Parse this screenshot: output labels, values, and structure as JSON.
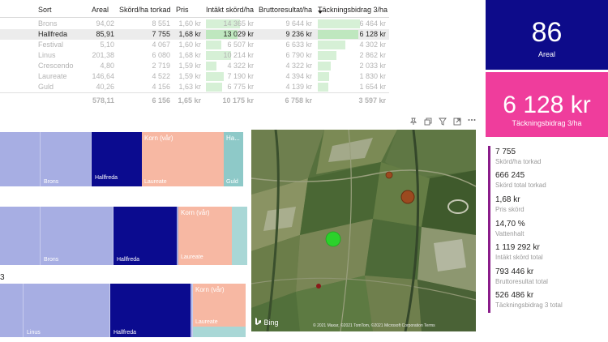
{
  "table": {
    "headers": [
      "Sort",
      "Areal",
      "Skörd/ha torkad",
      "Pris",
      "Intäkt skörd/ha",
      "Bruttoresultat/ha",
      "Täckningsbidrag 3/ha"
    ],
    "rows": [
      {
        "sort": "Brons",
        "areal": "94,02",
        "skord": "8 551",
        "pris": "1,60 kr",
        "intakt": "14 365 kr",
        "brutto": "9 644 kr",
        "tb": "6 464 kr",
        "intakt_frac": 0.72,
        "tb_frac": 0.62,
        "state": "dim"
      },
      {
        "sort": "Hallfreda",
        "areal": "85,91",
        "skord": "7 755",
        "pris": "1,68 kr",
        "intakt": "13 029 kr",
        "brutto": "9 236 kr",
        "tb": "6 128 kr",
        "intakt_frac": 0.66,
        "tb_frac": 0.59,
        "state": "sel"
      },
      {
        "sort": "Festival",
        "areal": "5,10",
        "skord": "4 067",
        "pris": "1,60 kr",
        "intakt": "6 507 kr",
        "brutto": "6 633 kr",
        "tb": "4 302 kr",
        "intakt_frac": 0.33,
        "tb_frac": 0.41,
        "state": "dim"
      },
      {
        "sort": "Linus",
        "areal": "201,38",
        "skord": "6 080",
        "pris": "1,68 kr",
        "intakt": "10 214 kr",
        "brutto": "6 790 kr",
        "tb": "2 862 kr",
        "intakt_frac": 0.52,
        "tb_frac": 0.27,
        "state": "dim"
      },
      {
        "sort": "Crescendo",
        "areal": "4,80",
        "skord": "2 719",
        "pris": "1,59 kr",
        "intakt": "4 322 kr",
        "brutto": "4 322 kr",
        "tb": "2 033 kr",
        "intakt_frac": 0.22,
        "tb_frac": 0.19,
        "state": "dim"
      },
      {
        "sort": "Laureate",
        "areal": "146,64",
        "skord": "4 522",
        "pris": "1,59 kr",
        "intakt": "7 190 kr",
        "brutto": "4 394 kr",
        "tb": "1 830 kr",
        "intakt_frac": 0.37,
        "tb_frac": 0.17,
        "state": "dim"
      },
      {
        "sort": "Guld",
        "areal": "40,26",
        "skord": "4 156",
        "pris": "1,63 kr",
        "intakt": "6 775 kr",
        "brutto": "4 139 kr",
        "tb": "1 654 kr",
        "intakt_frac": 0.34,
        "tb_frac": 0.16,
        "state": "dim"
      }
    ],
    "total": {
      "areal": "578,11",
      "skord": "6 156",
      "pris": "1,65 kr",
      "intakt": "10 175 kr",
      "brutto": "6 758 kr",
      "tb": "3 597 kr"
    }
  },
  "kpi_areal": {
    "value": "86",
    "label": "Areal"
  },
  "kpi_tb": {
    "value": "6 128 kr",
    "label": "Täckningsbidrag 3/ha"
  },
  "multi_card": [
    {
      "value": "7 755",
      "label": "Skörd/ha torkad"
    },
    {
      "value": "666 245",
      "label": "Skörd total torkad"
    },
    {
      "value": "1,68 kr",
      "label": "Pris skörd"
    },
    {
      "value": "14,70 %",
      "label": "Vattenhalt"
    },
    {
      "value": "1 119 292 kr",
      "label": "Intäkt skörd total"
    },
    {
      "value": "793 446 kr",
      "label": "Bruttoresultat total"
    },
    {
      "value": "526 486 kr",
      "label": "Täckningsbidrag 3 total"
    }
  ],
  "treemap1": {
    "brons": "Brons",
    "hallfreda": "Hallfreda",
    "korn": "Korn (vår)",
    "laureate": "Laureate",
    "ha": "Ha...",
    "guld": "Guld"
  },
  "treemap2": {
    "brons": "Brons",
    "hallfreda": "Hallfreda",
    "korn": "Korn (vår)",
    "laureate": "Laureate"
  },
  "treemap3": {
    "partial": "3",
    "linus": "Linus",
    "hallfreda": "Hallfreda",
    "korn": "Korn (vår)",
    "laureate": "Laureate"
  },
  "map": {
    "bing": "Bing",
    "copyright": "© 2021 Maxar, ©2021 TomTom, ©2021 Microsoft Corporation Terms"
  },
  "toolbar_icons": [
    "pin-icon",
    "copy-icon",
    "filter-icon",
    "focus-mode-icon",
    "more-options-icon"
  ],
  "colors": {
    "kpi_areal_bg": "#0d0b8a",
    "kpi_tb_bg": "#ef3d9c",
    "treemap_lavender": "#a7aee3",
    "treemap_navy": "#0b0b8f",
    "treemap_peach": "#f7b8a3",
    "treemap_teal": "#8ec9c8",
    "data_bar": "#d6f0d6",
    "card_accent": "#8a1c8a",
    "bubble_green": "#2bd12b",
    "bubble_brown": "#9c4a1f"
  }
}
